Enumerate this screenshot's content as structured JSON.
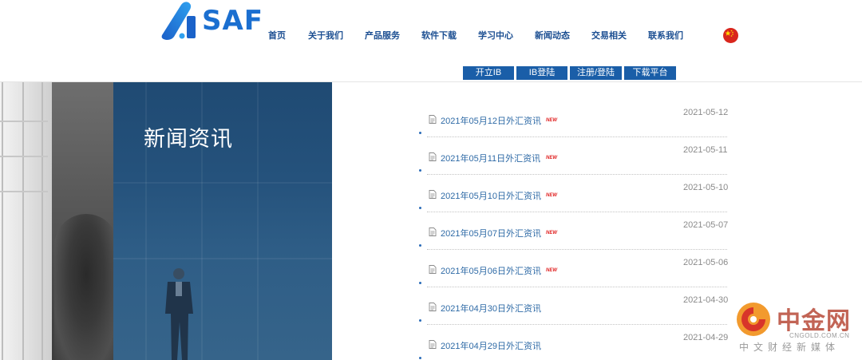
{
  "header": {
    "logo_text": "SAF",
    "nav": [
      "首页",
      "关于我们",
      "产品服务",
      "软件下载",
      "学习中心",
      "新闻动态",
      "交易相关",
      "联系我们"
    ],
    "flag_icon": "china-flag-icon",
    "sub_buttons": [
      "开立IB",
      "IB登陆",
      "注册/登陆",
      "下载平台"
    ]
  },
  "colors": {
    "brand_blue": "#1b6fd0",
    "nav_text": "#1c4f92",
    "sub_button_bg": "#1a5ea8",
    "news_link": "#2e6aa6",
    "new_badge": "#e02020"
  },
  "banner": {
    "title": "新闻资讯"
  },
  "news": {
    "doc_icon": "document-icon",
    "items": [
      {
        "title": "2021年05月12日外汇资讯",
        "is_new": true,
        "badge": "NEW",
        "date": "2021-05-12"
      },
      {
        "title": "2021年05月11日外汇资讯",
        "is_new": true,
        "badge": "NEW",
        "date": "2021-05-11"
      },
      {
        "title": "2021年05月10日外汇资讯",
        "is_new": true,
        "badge": "NEW",
        "date": "2021-05-10"
      },
      {
        "title": "2021年05月07日外汇资讯",
        "is_new": true,
        "badge": "NEW",
        "date": "2021-05-07"
      },
      {
        "title": "2021年05月06日外汇资讯",
        "is_new": true,
        "badge": "NEW",
        "date": "2021-05-06"
      },
      {
        "title": "2021年04月30日外汇资讯",
        "is_new": false,
        "badge": "",
        "date": "2021-04-30"
      },
      {
        "title": "2021年04月29日外汇资讯",
        "is_new": false,
        "badge": "",
        "date": "2021-04-29"
      }
    ]
  },
  "watermark": {
    "logo_icon": "cngold-logo-icon",
    "name": "中金网",
    "url": "CNGOLD.COM.CN",
    "slogan": "中文财经新媒体"
  }
}
